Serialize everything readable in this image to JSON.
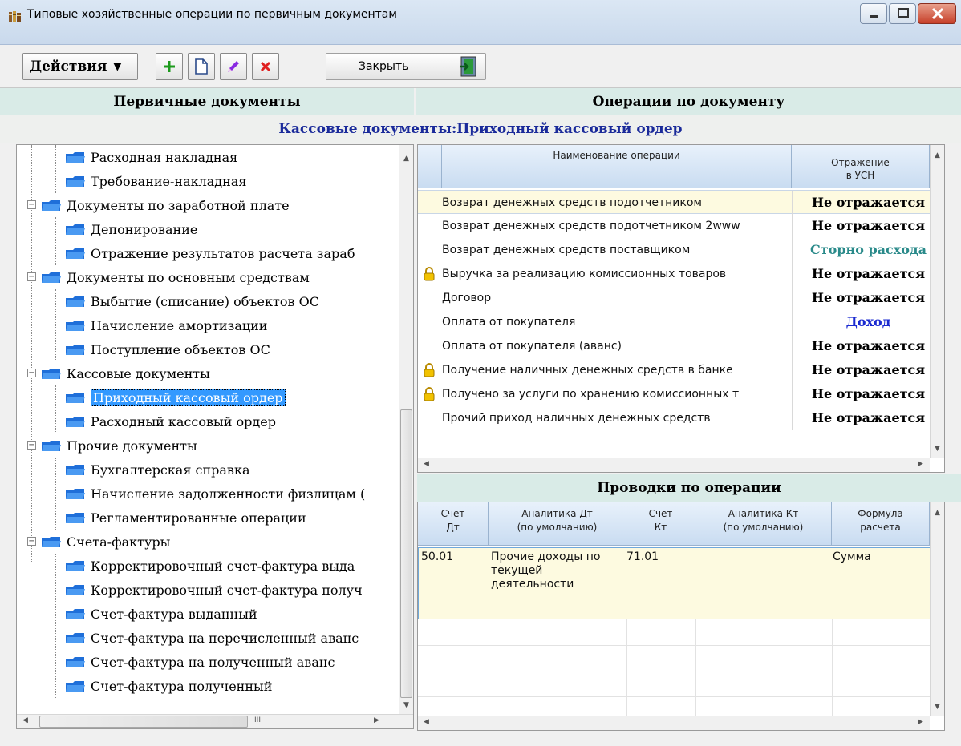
{
  "window": {
    "title": "Типовые хозяйственные операции по первичным документам"
  },
  "toolbar": {
    "actions_label": "Действия",
    "close_label": "Закрыть"
  },
  "left_panel": {
    "header": "Первичные документы"
  },
  "right_panel": {
    "header": "Операции по документу"
  },
  "document_path": "Кассовые документы:Приходный кассовый ордер",
  "tree": [
    {
      "label": "Расходная накладная"
    },
    {
      "label": "Требование-накладная"
    },
    {
      "label": "Документы по заработной плате"
    },
    {
      "label": "Депонирование"
    },
    {
      "label": "Отражение результатов расчета зараб"
    },
    {
      "label": "Документы по основным средствам"
    },
    {
      "label": "Выбытие (списание) объектов ОС"
    },
    {
      "label": "Начисление амортизации"
    },
    {
      "label": "Поступление объектов ОС"
    },
    {
      "label": "Кассовые документы"
    },
    {
      "label": "Приходный кассовый ордер"
    },
    {
      "label": "Расходный кассовый ордер"
    },
    {
      "label": "Прочие документы"
    },
    {
      "label": "Бухгалтерская справка"
    },
    {
      "label": "Начисление задолженности физлицам ("
    },
    {
      "label": "Регламентированные операции"
    },
    {
      "label": "Счета-фактуры"
    },
    {
      "label": "Корректировочный счет-фактура выда"
    },
    {
      "label": "Корректировочный счет-фактура получ"
    },
    {
      "label": "Счет-фактура выданный"
    },
    {
      "label": "Счет-фактура на перечисленный аванс"
    },
    {
      "label": "Счет-фактура на полученный аванс"
    },
    {
      "label": "Счет-фактура полученный"
    }
  ],
  "operations": {
    "col_name": "Наименование операции",
    "col_usn_1": "Отражение",
    "col_usn_2": "в УСН",
    "rows": [
      {
        "name": "Возврат денежных средств подотчетником",
        "usn": "Не отражается"
      },
      {
        "name": "Возврат денежных средств подотчетником 2www",
        "usn": "Не отражается"
      },
      {
        "name": "Возврат денежных средств поставщиком",
        "usn": "Сторно расхода"
      },
      {
        "name": "Выручка за реализацию комиссионных товаров",
        "usn": "Не отражается"
      },
      {
        "name": "Договор",
        "usn": "Не отражается"
      },
      {
        "name": "Оплата от покупателя",
        "usn": "Доход"
      },
      {
        "name": "Оплата от покупателя (аванс)",
        "usn": "Не отражается"
      },
      {
        "name": "Получение наличных денежных средств в банке",
        "usn": "Не отражается"
      },
      {
        "name": "Получено за услуги по хранению комиссионных т",
        "usn": "Не отражается"
      },
      {
        "name": "Прочий приход наличных денежных средств",
        "usn": "Не отражается"
      }
    ]
  },
  "postings": {
    "header": "Проводки по операции",
    "col_dt_1": "Счет",
    "col_dt_2": "Дт",
    "col_an_dt_1": "Аналитика Дт",
    "col_an_dt_2": "(по умолчанию)",
    "col_kt_1": "Счет",
    "col_kt_2": "Кт",
    "col_an_kt_1": "Аналитика Кт",
    "col_an_kt_2": "(по умолчанию)",
    "col_formula_1": "Формула",
    "col_formula_2": "расчета",
    "row": {
      "dt": "50.01",
      "an_dt_1": "Прочие доходы по",
      "an_dt_2": "текущей",
      "an_dt_3": "деятельности",
      "kt": "71.01",
      "formula": "Сумма"
    }
  },
  "colors": {
    "not_reflected": "#000000",
    "storno": "#2a8a8a",
    "income": "#1a2ad0",
    "selection": "#3399ff"
  }
}
